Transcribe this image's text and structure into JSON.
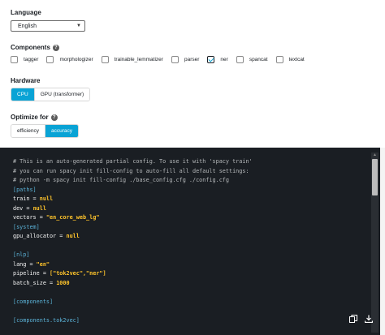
{
  "form": {
    "language": {
      "label": "Language",
      "value": "English"
    },
    "components": {
      "label": "Components",
      "items": [
        {
          "label": "tagger",
          "checked": false
        },
        {
          "label": "morphologizer",
          "checked": false
        },
        {
          "label": "trainable_lemmatizer",
          "checked": false
        },
        {
          "label": "parser",
          "checked": false
        },
        {
          "label": "ner",
          "checked": true
        },
        {
          "label": "spancat",
          "checked": false
        },
        {
          "label": "textcat",
          "checked": false
        }
      ]
    },
    "hardware": {
      "label": "Hardware",
      "options": [
        {
          "label": "CPU",
          "active": true
        },
        {
          "label": "GPU (transformer)",
          "active": false
        }
      ]
    },
    "optimize": {
      "label": "Optimize for",
      "options": [
        {
          "label": "efficiency",
          "active": false
        },
        {
          "label": "accuracy",
          "active": true
        }
      ]
    }
  },
  "config_code": {
    "lines": [
      [
        {
          "t": "# This is an auto-generated partial config. To use it with 'spacy train'",
          "c": "comment"
        }
      ],
      [
        {
          "t": "# you can run spacy init fill-config to auto-fill all default settings:",
          "c": "comment"
        }
      ],
      [
        {
          "t": "# python -m spacy init fill-config ./base_config.cfg ./config.cfg",
          "c": "comment"
        }
      ],
      [
        {
          "t": "[paths]",
          "c": "section"
        }
      ],
      [
        {
          "t": "train",
          "c": "key"
        },
        {
          "t": " = ",
          "c": "op"
        },
        {
          "t": "null",
          "c": "val"
        }
      ],
      [
        {
          "t": "dev",
          "c": "key"
        },
        {
          "t": " = ",
          "c": "op"
        },
        {
          "t": "null",
          "c": "val"
        }
      ],
      [
        {
          "t": "vectors",
          "c": "key"
        },
        {
          "t": " = ",
          "c": "op"
        },
        {
          "t": "\"en_core_web_lg\"",
          "c": "val"
        }
      ],
      [
        {
          "t": "[system]",
          "c": "section"
        }
      ],
      [
        {
          "t": "gpu_allocator",
          "c": "key"
        },
        {
          "t": " = ",
          "c": "op"
        },
        {
          "t": "null",
          "c": "val"
        }
      ],
      [],
      [
        {
          "t": "[nlp]",
          "c": "section"
        }
      ],
      [
        {
          "t": "lang",
          "c": "key"
        },
        {
          "t": " = ",
          "c": "op"
        },
        {
          "t": "\"en\"",
          "c": "val"
        }
      ],
      [
        {
          "t": "pipeline",
          "c": "key"
        },
        {
          "t": " = ",
          "c": "op"
        },
        {
          "t": "[\"tok2vec\",\"ner\"]",
          "c": "val"
        }
      ],
      [
        {
          "t": "batch_size",
          "c": "key"
        },
        {
          "t": " = ",
          "c": "op"
        },
        {
          "t": "1000",
          "c": "val"
        }
      ],
      [],
      [
        {
          "t": "[components]",
          "c": "section"
        }
      ],
      [],
      [
        {
          "t": "[components.tok2vec]",
          "c": "section"
        }
      ]
    ]
  },
  "icons": {
    "help": "help-circle-icon",
    "copy": "copy-icon",
    "download": "download-icon"
  },
  "colors": {
    "accent": "#09a3d5",
    "code_bg": "#1a1e23",
    "code_value": "#ffc42b",
    "code_section": "#5bb3d8"
  }
}
